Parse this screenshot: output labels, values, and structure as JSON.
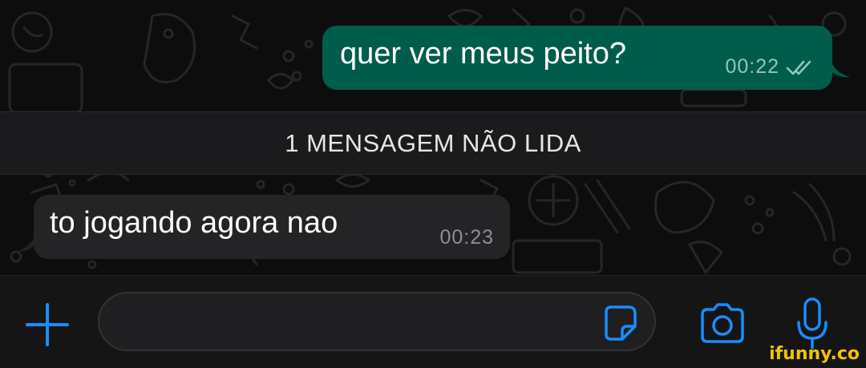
{
  "chat": {
    "outgoing": {
      "text": "quer ver meus peito?",
      "time": "00:22",
      "status": "read"
    },
    "unread_divider": "1 MENSAGEM NÃO LIDA",
    "incoming": {
      "text": "to jogando agora nao",
      "time": "00:23"
    }
  },
  "composer": {
    "placeholder": "",
    "value": ""
  },
  "colors": {
    "accent": "#1a8cff",
    "outgoing_bubble": "#005c4b",
    "incoming_bubble": "#242426",
    "watermark": "#f2c200"
  },
  "icons": [
    "plus-icon",
    "sticker-icon",
    "camera-icon",
    "microphone-icon",
    "double-check-icon"
  ],
  "watermark": "ifunny.co"
}
